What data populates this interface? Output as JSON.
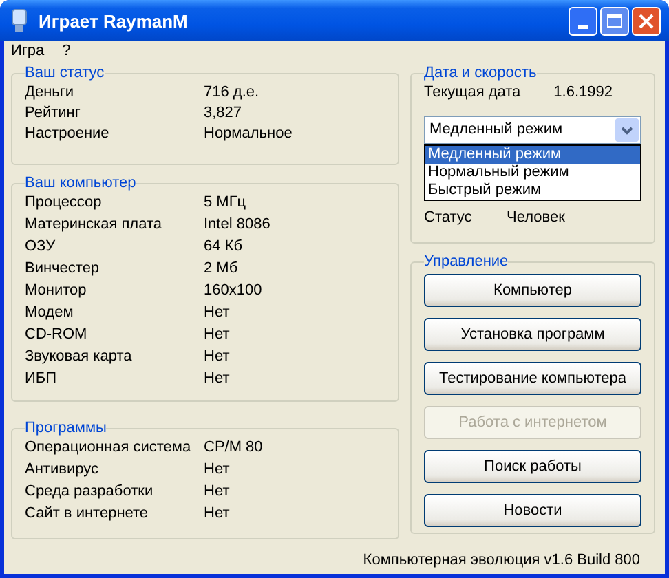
{
  "window": {
    "title": "Играет RaymanM"
  },
  "menu": [
    "Игра",
    "?"
  ],
  "status_group": {
    "title": "Ваш статус",
    "rows": [
      {
        "label": "Деньги",
        "value": "716 д.е."
      },
      {
        "label": "Рейтинг",
        "value": "3,827"
      },
      {
        "label": "Настроение",
        "value": "Нормальное"
      }
    ]
  },
  "computer_group": {
    "title": "Ваш компьютер",
    "rows": [
      {
        "label": "Процессор",
        "value": "5 МГц"
      },
      {
        "label": "Материнская плата",
        "value": "Intel 8086"
      },
      {
        "label": "ОЗУ",
        "value": "64 Кб"
      },
      {
        "label": "Винчестер",
        "value": "2 Мб"
      },
      {
        "label": "Монитор",
        "value": "160x100"
      },
      {
        "label": "Модем",
        "value": "Нет"
      },
      {
        "label": "CD-ROM",
        "value": "Нет"
      },
      {
        "label": "Звуковая карта",
        "value": "Нет"
      },
      {
        "label": "ИБП",
        "value": "Нет"
      }
    ]
  },
  "programs_group": {
    "title": "Программы",
    "rows": [
      {
        "label": "Операционная система",
        "value": "CP/M 80"
      },
      {
        "label": "Антивирус",
        "value": "Нет"
      },
      {
        "label": "Среда разработки",
        "value": "Нет"
      },
      {
        "label": "Сайт в интернете",
        "value": "Нет"
      }
    ]
  },
  "date_speed": {
    "title": "Дата и скорость",
    "date_label": "Текущая дата",
    "date_value": "1.6.1992",
    "speed_select": {
      "value": "Медленный режим",
      "expanded": true,
      "options": [
        {
          "label": "Медленный режим",
          "selected": true
        },
        {
          "label": "Нормальный режим",
          "selected": false
        },
        {
          "label": "Быстрый режим",
          "selected": false
        }
      ]
    },
    "rows": [
      {
        "label": "Статус",
        "value": "Человек"
      }
    ]
  },
  "controls": {
    "title": "Управление",
    "buttons": [
      {
        "label": "Компьютер",
        "disabled": false
      },
      {
        "label": "Установка программ",
        "disabled": false
      },
      {
        "label": "Тестирование компьютера",
        "disabled": false
      },
      {
        "label": "Работа с интернетом",
        "disabled": true
      },
      {
        "label": "Поиск работы",
        "disabled": false
      },
      {
        "label": "Новости",
        "disabled": false
      }
    ]
  },
  "status_bar": "Компьютерная эволюция v1.6 Build 800"
}
